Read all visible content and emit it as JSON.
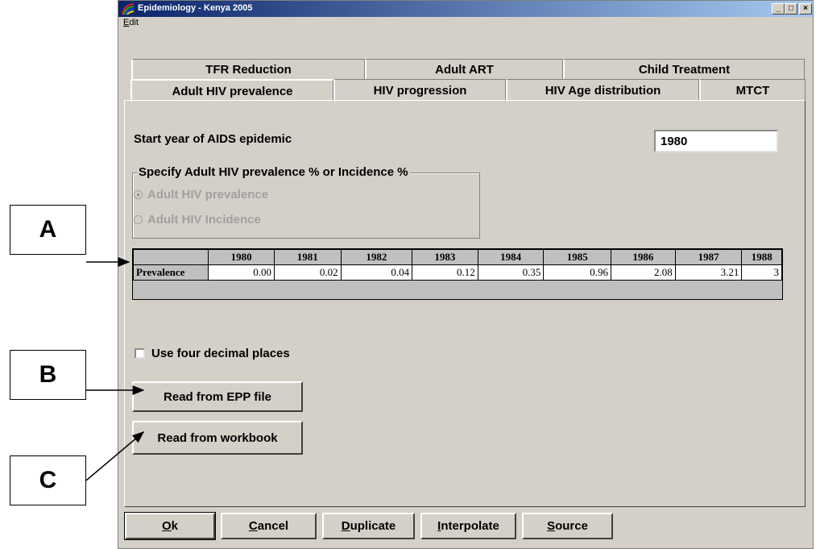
{
  "window": {
    "title": "Epidemiology - Kenya 2005",
    "menu": {
      "edit_label": "Edit",
      "edit_underline": "E",
      "edit_rest": "dit"
    },
    "controls": {
      "minimize": "_",
      "maximize": "□",
      "close": "×"
    }
  },
  "tabs": {
    "back_row": [
      "TFR Reduction",
      "Adult ART",
      "Child Treatment"
    ],
    "front_row": [
      "Adult HIV prevalence",
      "HIV progression",
      "HIV Age distribution",
      "MTCT"
    ],
    "active": "Adult HIV prevalence"
  },
  "form": {
    "start_year_label": "Start year of AIDS epidemic",
    "start_year_value": "1980",
    "group_title": "Specify Adult HIV prevalence % or Incidence %",
    "radio_prevalence": "Adult HIV prevalence",
    "radio_incidence": "Adult HIV Incidence",
    "selected_radio": "prevalence",
    "checkbox_label": "Use four decimal places",
    "checkbox_checked": false
  },
  "grid": {
    "years": [
      "1980",
      "1981",
      "1982",
      "1983",
      "1984",
      "1985",
      "1986",
      "1987",
      "1988"
    ],
    "row_label": "Prevalence",
    "values": [
      "0.00",
      "0.02",
      "0.04",
      "0.12",
      "0.35",
      "0.96",
      "2.08",
      "3.21",
      "3"
    ]
  },
  "buttons": {
    "read_epp": "Read from EPP file",
    "read_workbook": "Read from workbook",
    "ok": {
      "mnemonic": "O",
      "rest": "k"
    },
    "cancel": {
      "mnemonic": "C",
      "rest": "ancel"
    },
    "duplicate": {
      "mnemonic": "D",
      "rest": "uplicate"
    },
    "interpolate": {
      "mnemonic": "I",
      "rest": "nterpolate"
    },
    "source": {
      "mnemonic": "S",
      "rest": "ource"
    }
  },
  "annotations": [
    "A",
    "B",
    "C"
  ],
  "colors": {
    "face": "#d4d0c8",
    "title_start": "#0a246a",
    "title_end": "#a6caf0"
  }
}
